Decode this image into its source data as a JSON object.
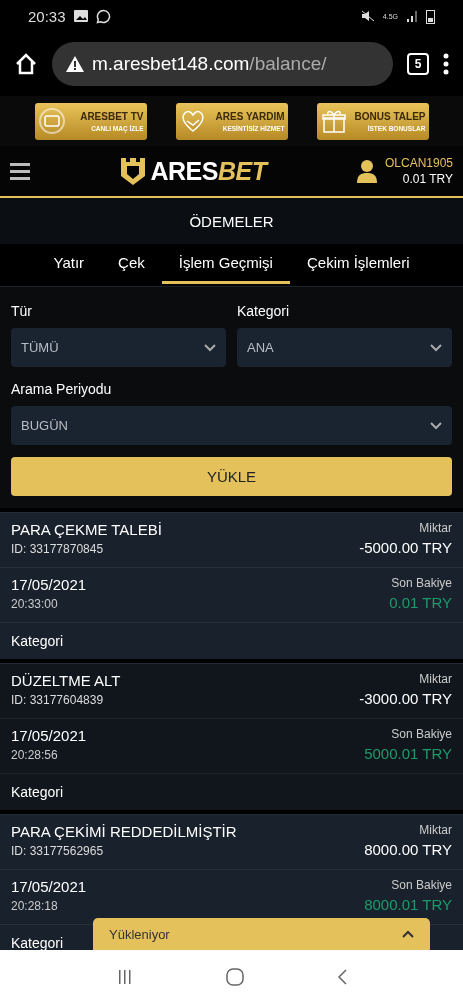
{
  "status_bar": {
    "time": "20:33",
    "network": "4.5G"
  },
  "browser": {
    "url_host": "m.aresbet148.com",
    "url_path": "/balance/",
    "tab_count": "5"
  },
  "banners": [
    {
      "title": "ARESBET TV",
      "subtitle": "CANLI MAÇ İZLE",
      "kind": "tv"
    },
    {
      "title": "ARES YARDIM",
      "subtitle": "KESİNTİSİZ HİZMET",
      "kind": "help"
    },
    {
      "title": "BONUS TALEP",
      "subtitle": "İSTEK BONUSLAR",
      "kind": "gift"
    }
  ],
  "header": {
    "logo": [
      "ARES",
      "BET"
    ],
    "username": "OLCAN1905",
    "balance": "0.01 TRY"
  },
  "page_title": "ÖDEMELER",
  "tabs": [
    {
      "label": "Yatır",
      "selected": false
    },
    {
      "label": "Çek",
      "selected": false
    },
    {
      "label": "İşlem Geçmişi",
      "selected": true
    },
    {
      "label": "Çekim İşlemleri",
      "selected": false
    }
  ],
  "filters": [
    {
      "label": "Tür",
      "value": "TÜMÜ"
    },
    {
      "label": "Kategori",
      "value": "ANA"
    },
    {
      "label": "Arama Periyodu",
      "value": "BUGÜN"
    }
  ],
  "load_button": "YÜKLE",
  "transactions": [
    {
      "title": "PARA ÇEKME TALEBİ",
      "id": "ID: 33177870845",
      "amount_label": "Miktar",
      "amount": "-5000.00 TRY",
      "date": "17/05/2021",
      "time": "20:33:00",
      "balance_label": "Son Bakiye",
      "balance": "0.01 TRY",
      "category_label": "Kategori"
    },
    {
      "title": "DÜZELTME ALT",
      "id": "ID: 33177604839",
      "amount_label": "Miktar",
      "amount": "-3000.00 TRY",
      "date": "17/05/2021",
      "time": "20:28:56",
      "balance_label": "Son Bakiye",
      "balance": "5000.01 TRY",
      "category_label": "Kategori"
    },
    {
      "title": "PARA ÇEKİMİ REDDEDİLMİŞTİR",
      "id": "ID: 33177562965",
      "amount_label": "Miktar",
      "amount": "8000.00 TRY",
      "date": "17/05/2021",
      "time": "20:28:18",
      "balance_label": "Son Bakiye",
      "balance": "8000.01 TRY",
      "category_label": "Kategori"
    }
  ],
  "loading_bar": {
    "label": "Yükleniyor",
    "expanded": false
  }
}
